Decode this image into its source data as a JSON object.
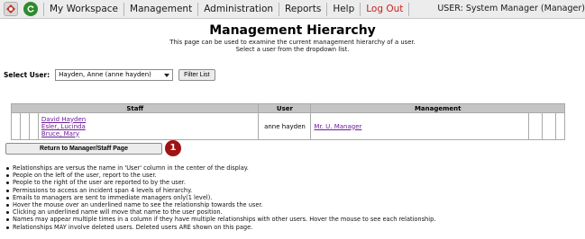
{
  "nav": {
    "items": [
      "My Workspace",
      "Management",
      "Administration",
      "Reports",
      "Help"
    ],
    "logout": "Log Out",
    "user": "USER: System Manager (Manager)"
  },
  "header": {
    "title": "Management Hierarchy",
    "subtitle1": "This page can be used to examine the current management hierarchy of a user.",
    "subtitle2": "Select a user from the dropdown list."
  },
  "filter": {
    "label": "Select User:",
    "selected": "Hayden, Anne (anne hayden)",
    "button": "Filter List"
  },
  "table": {
    "headers": {
      "staff": "Staff",
      "user": "User",
      "management": "Management"
    },
    "staff": [
      "David Hayden",
      "Esler, Lucinda",
      "Bruce, Mary"
    ],
    "user": "anne hayden",
    "management": "Mr. U. Manager"
  },
  "return_button": "Return to Manager/Staff Page",
  "badge": "1",
  "notes": [
    "Relationships are versus the name in 'User' column in the center of the display.",
    "People on the left of the user, report to the user.",
    "People to the right of the user are reported to by the user.",
    "Permissions to access an incident span 4 levels of hierarchy.",
    "Emails to managers are sent to immediate managers only(1 level).",
    "Hover the mouse over an underlined name to see the relationship towards the user.",
    "Clicking an underlined name will move that name to the user position.",
    "Names may appear multiple times in a column if they have multiple relationships with other users. Hover the mouse to see each relationship.",
    "Relationships MAY involve deleted users. Deleted users ARE shown on this page."
  ]
}
